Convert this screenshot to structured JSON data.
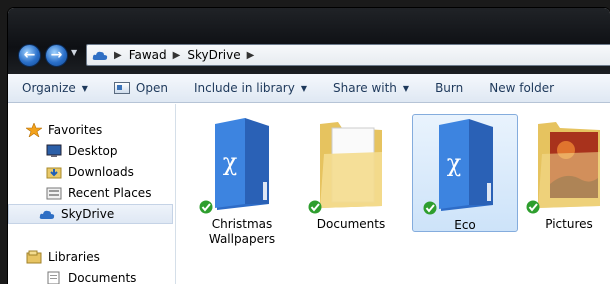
{
  "address": {
    "crumbs": [
      "Fawad",
      "SkyDrive"
    ]
  },
  "toolbar": {
    "organize": "Organize",
    "open": "Open",
    "include": "Include in library",
    "share": "Share with",
    "burn": "Burn",
    "newfolder": "New folder"
  },
  "nav": {
    "favorites": "Favorites",
    "desktop": "Desktop",
    "downloads": "Downloads",
    "recent": "Recent Places",
    "skydrive": "SkyDrive",
    "libraries": "Libraries",
    "documents": "Documents"
  },
  "files": [
    {
      "name": "Christmas Wallpapers",
      "icon": "skydrive-blue-folder-icon"
    },
    {
      "name": "Documents",
      "icon": "yellow-folder-documents-icon"
    },
    {
      "name": "Eco",
      "icon": "skydrive-blue-folder-icon",
      "selected": true
    },
    {
      "name": "Pictures",
      "icon": "yellow-folder-pictures-icon"
    }
  ],
  "colors": {
    "accent": "#2a6fc9",
    "selection": "#cde3f9",
    "sync_check": "#2e9e2e"
  }
}
